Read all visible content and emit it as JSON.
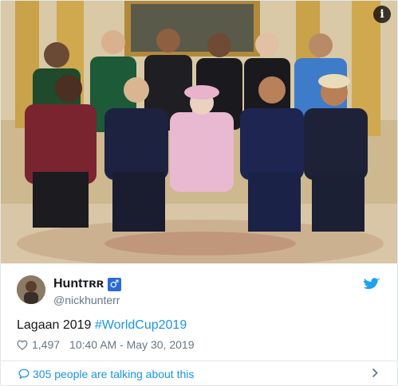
{
  "photo": {
    "alt_icon": "info-icon",
    "info_glyph": "i"
  },
  "tweet": {
    "display_name": "Huntᴛʀʀ",
    "gender_symbol": "♂",
    "handle": "@nickhunterr",
    "text_plain": "Lagaan 2019 ",
    "hashtag": "#WorldCup2019",
    "likes": "1,497",
    "timestamp": "10:40 AM - May 30, 2019"
  },
  "footer": {
    "talking_text": "305 people are talking about this"
  },
  "colors": {
    "link": "#1b95e0",
    "muted": "#657786",
    "text": "#14171a",
    "border": "#e1e8ed"
  }
}
